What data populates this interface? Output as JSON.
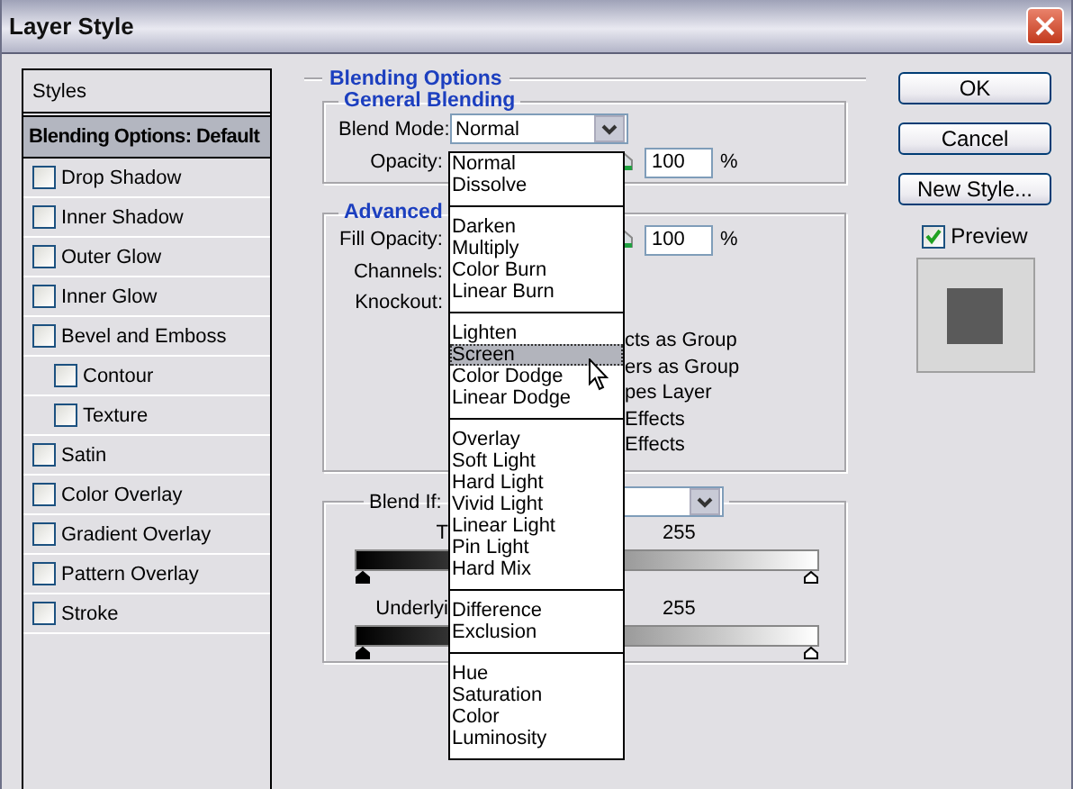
{
  "window": {
    "title": "Layer Style"
  },
  "styles_list": {
    "header": "Styles",
    "items": [
      {
        "label": "Blending Options: Default",
        "kind": "heading",
        "selected": true
      },
      {
        "label": "Drop Shadow",
        "kind": "checkbox",
        "checked": false,
        "selected": false
      },
      {
        "label": "Inner Shadow",
        "kind": "checkbox",
        "checked": false,
        "selected": false
      },
      {
        "label": "Outer Glow",
        "kind": "checkbox",
        "checked": false,
        "selected": false
      },
      {
        "label": "Inner Glow",
        "kind": "checkbox",
        "checked": false,
        "selected": false
      },
      {
        "label": "Bevel and Emboss",
        "kind": "checkbox",
        "checked": false,
        "selected": false,
        "children": [
          {
            "label": "Contour",
            "kind": "checkbox",
            "checked": false,
            "selected": false
          },
          {
            "label": "Texture",
            "kind": "checkbox",
            "checked": false,
            "selected": false
          }
        ]
      },
      {
        "label": "Satin",
        "kind": "checkbox",
        "checked": false,
        "selected": false
      },
      {
        "label": "Color Overlay",
        "kind": "checkbox",
        "checked": false,
        "selected": false
      },
      {
        "label": "Gradient Overlay",
        "kind": "checkbox",
        "checked": false,
        "selected": false
      },
      {
        "label": "Pattern Overlay",
        "kind": "checkbox",
        "checked": false,
        "selected": false
      },
      {
        "label": "Stroke",
        "kind": "checkbox",
        "checked": false,
        "selected": false
      }
    ]
  },
  "blending_options": {
    "title": "Blending Options",
    "general": {
      "title": "General Blending",
      "blend_mode": {
        "label": "Blend Mode:",
        "value": "Normal"
      },
      "opacity": {
        "label": "Opacity:",
        "value": "100",
        "unit": "%"
      }
    },
    "advanced": {
      "title": "Advanced",
      "fill_opacity": {
        "label": "Fill Opacity:",
        "value": "100",
        "unit": "%"
      },
      "channels": {
        "label": "Channels:"
      },
      "knockout": {
        "label": "Knockout:"
      },
      "options": [
        "cts as Group",
        "ers as Group",
        "pes Layer",
        "Effects",
        "Effects"
      ]
    },
    "blend_if": {
      "label": "Blend If:",
      "this_layer": {
        "label": "T",
        "max": "255"
      },
      "underlying": {
        "label": "Underlyi",
        "max": "255"
      }
    }
  },
  "blend_menu": {
    "groups": [
      [
        {
          "label": "Normal",
          "selected": false
        },
        {
          "label": "Dissolve",
          "selected": false
        }
      ],
      [
        {
          "label": "Darken",
          "selected": false
        },
        {
          "label": "Multiply",
          "selected": false
        },
        {
          "label": "Color Burn",
          "selected": false
        },
        {
          "label": "Linear Burn",
          "selected": false
        }
      ],
      [
        {
          "label": "Lighten",
          "selected": false
        },
        {
          "label": "Screen",
          "selected": true
        },
        {
          "label": "Color Dodge",
          "selected": false
        },
        {
          "label": "Linear Dodge",
          "selected": false
        }
      ],
      [
        {
          "label": "Overlay",
          "selected": false
        },
        {
          "label": "Soft Light",
          "selected": false
        },
        {
          "label": "Hard Light",
          "selected": false
        },
        {
          "label": "Vivid Light",
          "selected": false
        },
        {
          "label": "Linear Light",
          "selected": false
        },
        {
          "label": "Pin Light",
          "selected": false
        },
        {
          "label": "Hard Mix",
          "selected": false
        }
      ],
      [
        {
          "label": "Difference",
          "selected": false
        },
        {
          "label": "Exclusion",
          "selected": false
        }
      ],
      [
        {
          "label": "Hue",
          "selected": false
        },
        {
          "label": "Saturation",
          "selected": false
        },
        {
          "label": "Color",
          "selected": false
        },
        {
          "label": "Luminosity",
          "selected": false
        }
      ]
    ]
  },
  "buttons": [
    "OK",
    "Cancel",
    "New Style..."
  ],
  "preview": {
    "label": "Preview",
    "checked": true
  }
}
